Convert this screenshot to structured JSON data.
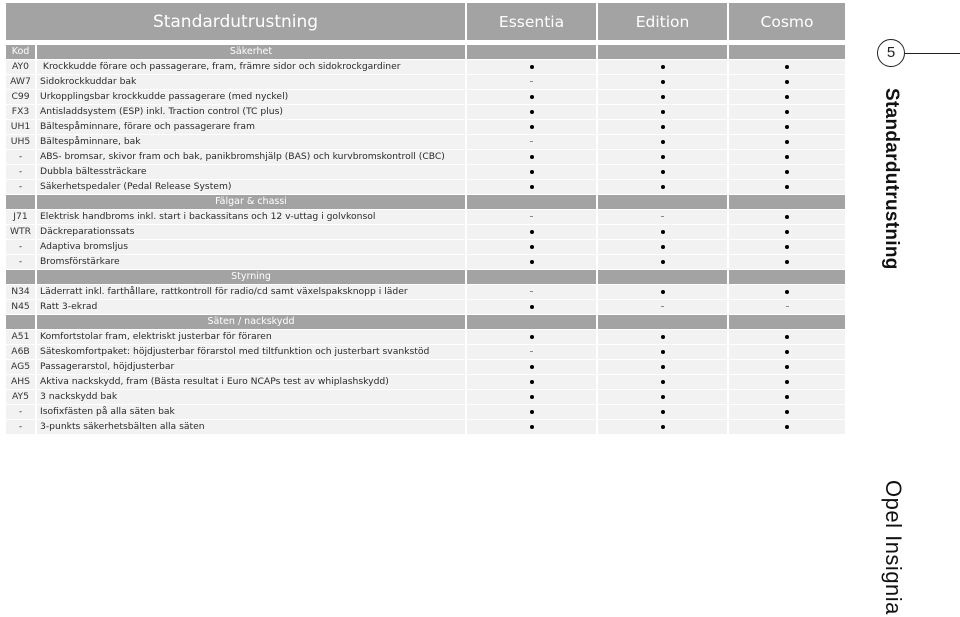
{
  "header": {
    "title": "Standardutrustning",
    "trims": [
      "Essentia",
      "Edition",
      "Cosmo"
    ]
  },
  "kod_label": "Kod",
  "sections": [
    {
      "title": "Säkerhet",
      "rows": [
        {
          "kod": "AY0",
          "desc": " Krockkudde förare och passagerare, fram, främre sidor och sidokrockgardiner",
          "values": [
            "dot",
            "dot",
            "dot"
          ]
        },
        {
          "kod": "AW7",
          "desc": "Sidokrockkuddar bak",
          "values": [
            "dash",
            "dot",
            "dot"
          ]
        },
        {
          "kod": "C99",
          "desc": "Urkopplingsbar krockkudde passagerare (med nyckel)",
          "values": [
            "dot",
            "dot",
            "dot"
          ]
        },
        {
          "kod": "FX3",
          "desc": "Antisladdsystem (ESP) inkl. Traction control (TC plus)",
          "values": [
            "dot",
            "dot",
            "dot"
          ]
        },
        {
          "kod": "UH1",
          "desc": "Bältespåminnare, förare och passagerare fram",
          "values": [
            "dot",
            "dot",
            "dot"
          ]
        },
        {
          "kod": "UH5",
          "desc": "Bältespåminnare, bak",
          "values": [
            "dash",
            "dot",
            "dot"
          ]
        },
        {
          "kod": "-",
          "desc": "ABS- bromsar, skivor fram och bak, panikbromshjälp (BAS) och kurvbromskontroll (CBC)",
          "values": [
            "dot",
            "dot",
            "dot"
          ]
        },
        {
          "kod": "-",
          "desc": "Dubbla bältessträckare",
          "values": [
            "dot",
            "dot",
            "dot"
          ]
        },
        {
          "kod": "-",
          "desc": "Säkerhetspedaler (Pedal Release System)",
          "values": [
            "dot",
            "dot",
            "dot"
          ]
        }
      ]
    },
    {
      "title": "Fälgar & chassi",
      "rows": [
        {
          "kod": "J71",
          "desc": "Elektrisk handbroms inkl. start i backassitans och 12 v-uttag i golvkonsol",
          "values": [
            "dash",
            "dash",
            "dot"
          ]
        },
        {
          "kod": "WTR",
          "desc": "Däckreparationssats",
          "values": [
            "dot",
            "dot",
            "dot"
          ]
        },
        {
          "kod": "-",
          "desc": "Adaptiva bromsljus",
          "values": [
            "dot",
            "dot",
            "dot"
          ]
        },
        {
          "kod": "-",
          "desc": "Bromsförstärkare",
          "values": [
            "dot",
            "dot",
            "dot"
          ]
        }
      ]
    },
    {
      "title": "Styrning",
      "rows": [
        {
          "kod": "N34",
          "desc": "Läderratt inkl. farthållare, rattkontroll för radio/cd samt växelspaksknopp i läder",
          "values": [
            "dash",
            "dot",
            "dot"
          ]
        },
        {
          "kod": "N45",
          "desc": "Ratt 3-ekrad",
          "values": [
            "dot",
            "dash",
            "dash"
          ]
        }
      ]
    },
    {
      "title": "Säten / nackskydd",
      "rows": [
        {
          "kod": "A51",
          "desc": "Komfortstolar fram, elektriskt justerbar för föraren",
          "values": [
            "dot",
            "dot",
            "dot"
          ]
        },
        {
          "kod": "A6B",
          "desc": "Säteskomfortpaket: höjdjusterbar förarstol med tiltfunktion och justerbart svankstöd",
          "values": [
            "dash",
            "dot",
            "dot"
          ]
        },
        {
          "kod": "AG5",
          "desc": "Passagerarstol, höjdjusterbar",
          "values": [
            "dot",
            "dot",
            "dot"
          ]
        },
        {
          "kod": "AHS",
          "desc": "Aktiva nackskydd, fram (Bästa resultat i Euro NCAPs test av whiplashskydd)",
          "values": [
            "dot",
            "dot",
            "dot"
          ]
        },
        {
          "kod": "AY5",
          "desc": "3 nackskydd bak",
          "values": [
            "dot",
            "dot",
            "dot"
          ]
        },
        {
          "kod": "-",
          "desc": "Isofixfästen på alla säten bak",
          "values": [
            "dot",
            "dot",
            "dot"
          ]
        },
        {
          "kod": "-",
          "desc": "3-punkts säkerhetsbälten alla säten",
          "values": [
            "dot",
            "dot",
            "dot"
          ]
        }
      ]
    }
  ],
  "legend": {
    "dot": "standard-dot-icon",
    "dash": "not-available-dash-icon"
  },
  "side": {
    "page_number": "5",
    "chapter_title": "Standardutrustning",
    "brand": "Opel Insignia"
  }
}
